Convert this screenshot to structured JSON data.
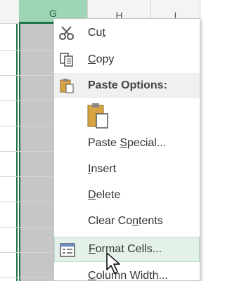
{
  "sheet": {
    "columns": [
      {
        "label": "G",
        "selected": true
      },
      {
        "label": "H",
        "selected": false
      },
      {
        "label": "I",
        "selected": false
      }
    ]
  },
  "context_menu": {
    "items": [
      {
        "label_pre": "Cu",
        "label_accel": "t",
        "label_post": "",
        "icon": "scissors-icon"
      },
      {
        "label_pre": "",
        "label_accel": "C",
        "label_post": "opy",
        "icon": "copy-icon"
      },
      {
        "label": "Paste Options:",
        "icon": "clipboard-icon",
        "is_header": true
      },
      {
        "label": "",
        "icon": "paste-clipboard-icon"
      },
      {
        "label_pre": "Paste ",
        "label_accel": "S",
        "label_post": "pecial...",
        "icon": ""
      },
      {
        "label_pre": "",
        "label_accel": "I",
        "label_post": "nsert",
        "icon": ""
      },
      {
        "label_pre": "",
        "label_accel": "D",
        "label_post": "elete",
        "icon": ""
      },
      {
        "label_pre": "Clear Co",
        "label_accel": "n",
        "label_post": "tents",
        "icon": ""
      },
      {
        "label_pre": "",
        "label_accel": "F",
        "label_post": "ormat Cells...",
        "icon": "format-cells-icon",
        "hover": true
      },
      {
        "label_pre": "",
        "label_accel": "C",
        "label_post": "olumn Width...",
        "icon": ""
      }
    ]
  },
  "colors": {
    "accent": "#217346",
    "hover_bg": "#e3f1e9",
    "selected_col_bg": "#c6c6c6"
  }
}
